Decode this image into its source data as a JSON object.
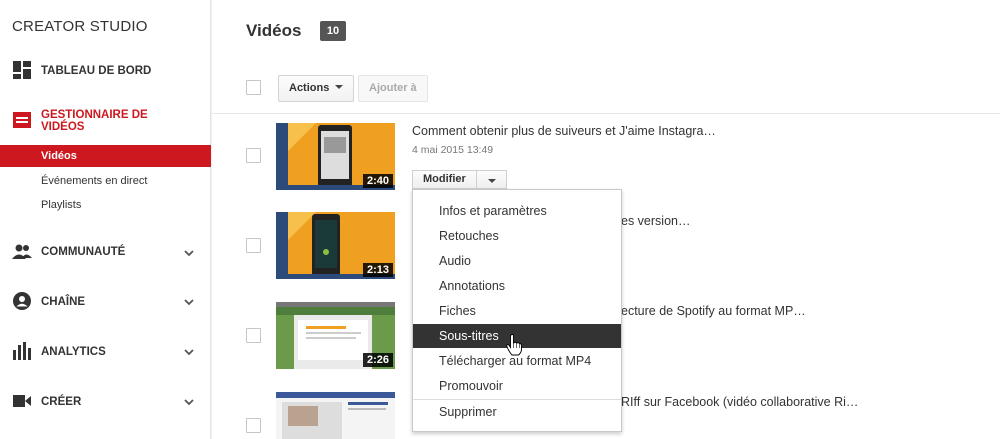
{
  "sidebar": {
    "brand": "CREATOR STUDIO",
    "sections": [
      {
        "label": "TABLEAU DE BORD",
        "icon": "dashboard-icon"
      },
      {
        "label": "GESTIONNAIRE DE VIDÉOS",
        "icon": "video-manager-icon",
        "active": true
      },
      {
        "label": "COMMUNAUTÉ",
        "icon": "community-icon"
      },
      {
        "label": "CHAÎNE",
        "icon": "channel-icon"
      },
      {
        "label": "ANALYTICS",
        "icon": "analytics-icon"
      },
      {
        "label": "CRÉER",
        "icon": "create-icon"
      }
    ],
    "sub_items": [
      {
        "label": "Vidéos",
        "selected": true
      },
      {
        "label": "Événements en direct"
      },
      {
        "label": "Playlists"
      }
    ]
  },
  "main": {
    "title": "Vidéos",
    "count": "10",
    "actions_label": "Actions",
    "add_to_label": "Ajouter à",
    "modify_label": "Modifier",
    "videos": [
      {
        "title": "Comment obtenir plus de suiveurs et J'aime Instagra…",
        "date": "4 mai 2015 13:49",
        "duration": "2:40"
      },
      {
        "title": "es version…",
        "duration": "2:13"
      },
      {
        "title": "ecture de Spotify au format MP…",
        "duration": "2:26"
      },
      {
        "title": "RIff sur Facebook (vidéo collaborative Ri…",
        "duration": ""
      }
    ]
  },
  "menu": {
    "items": [
      "Infos et paramètres",
      "Retouches",
      "Audio",
      "Annotations",
      "Fiches",
      "Sous-titres",
      "Télécharger au format MP4",
      "Promouvoir"
    ],
    "highlighted": "Sous-titres",
    "delete_label": "Supprimer"
  },
  "colors": {
    "accent": "#cc181e",
    "menu_highlight": "#333333",
    "badge": "#555555"
  }
}
